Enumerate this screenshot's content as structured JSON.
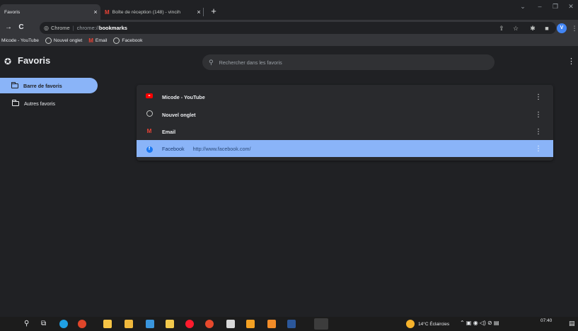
{
  "window": {
    "tabs": [
      {
        "title": "Favoris",
        "close": "×"
      },
      {
        "title": "Boîte de réception (148) - vincih",
        "close": "×"
      }
    ],
    "new_tab": "+",
    "controls": {
      "chevron": "⌄",
      "minimize": "–",
      "restore": "❐",
      "close": "✕"
    }
  },
  "toolbar": {
    "back": "→",
    "reload": "C",
    "site_label": "Chrome",
    "separator": "|",
    "url_host": "chrome://",
    "url_path": "bookmarks",
    "avatar_letter": "V"
  },
  "bookmarks_bar": [
    {
      "label": "Micode - YouTube",
      "icon": "youtube-icon"
    },
    {
      "label": "Nouvel onglet",
      "icon": "globe-icon"
    },
    {
      "label": "Email",
      "icon": "gmail-icon"
    },
    {
      "label": "Facebook",
      "icon": "globe-icon"
    }
  ],
  "page": {
    "title": "Favoris",
    "search_placeholder": "Rechercher dans les favoris"
  },
  "sidebar": {
    "items": [
      {
        "label": "Barre de favoris",
        "selected": true
      },
      {
        "label": "Autres favoris",
        "selected": false
      }
    ]
  },
  "bookmarks": [
    {
      "name": "Micode - YouTube",
      "url": "",
      "icon": "youtube-icon",
      "selected": false
    },
    {
      "name": "Nouvel onglet",
      "url": "",
      "icon": "globe-icon",
      "selected": false
    },
    {
      "name": "Email",
      "url": "",
      "icon": "gmail-icon",
      "selected": false
    },
    {
      "name": "Facebook",
      "url": "http://www.facebook.com/",
      "icon": "facebook-icon",
      "selected": true
    }
  ],
  "taskbar": {
    "weather": "14°C Éclaircies",
    "time": "07:40"
  },
  "colors": {
    "accent": "#8ab4f8",
    "background": "#202124",
    "surface": "#292a2d"
  }
}
